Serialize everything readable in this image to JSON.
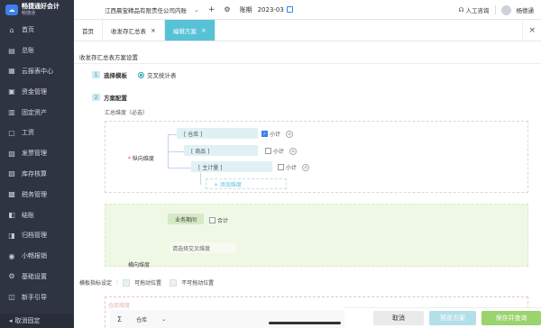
{
  "brand": {
    "name": "畅捷通好会计",
    "sub": "畅捷通"
  },
  "sidebar": {
    "items": [
      {
        "label": "首页",
        "icon": "home-icon",
        "glyph": "⌂"
      },
      {
        "label": "总账",
        "icon": "ledger-icon",
        "glyph": "▤"
      },
      {
        "label": "云报表中心",
        "icon": "report-icon",
        "glyph": "▦"
      },
      {
        "label": "资金管理",
        "icon": "fund-icon",
        "glyph": "▣"
      },
      {
        "label": "固定资产",
        "icon": "asset-icon",
        "glyph": "▥"
      },
      {
        "label": "工资",
        "icon": "salary-icon",
        "glyph": "▢"
      },
      {
        "label": "发票管理",
        "icon": "invoice-icon",
        "glyph": "▧"
      },
      {
        "label": "库存核算",
        "icon": "inventory-icon",
        "glyph": "▨"
      },
      {
        "label": "税务管理",
        "icon": "tax-icon",
        "glyph": "▩"
      },
      {
        "label": "结账",
        "icon": "close-period-icon",
        "glyph": "◧"
      },
      {
        "label": "归档管理",
        "icon": "archive-icon",
        "glyph": "◨"
      },
      {
        "label": "小畅报销",
        "icon": "reimburse-icon",
        "glyph": "◉"
      },
      {
        "label": "基础设置",
        "icon": "settings-icon",
        "glyph": "⚙"
      },
      {
        "label": "新手引导",
        "icon": "guide-icon",
        "glyph": "◫"
      },
      {
        "label": "畅会计",
        "icon": "app-icon",
        "glyph": "◪"
      }
    ],
    "footer": "取消固定"
  },
  "topbar": {
    "company": "江西晨宝精品有限责任公司内账",
    "period_label": "账期",
    "period_value": "2023-03",
    "service": "人工咨询",
    "user": "杨德通"
  },
  "tabs": [
    {
      "label": "首页",
      "active": false,
      "closable": false
    },
    {
      "label": "收发存汇总表",
      "active": false,
      "closable": true
    },
    {
      "label": "编辑方案",
      "active": true,
      "closable": true
    }
  ],
  "main": {
    "title": "收发存汇总表方案设置",
    "step1": {
      "num": "1",
      "label": "选择模板",
      "option": "交叉统计表"
    },
    "step2": {
      "num": "2",
      "label": "方案配置"
    },
    "summary_dim_label": "汇总维度（必选）",
    "vertical_dim_label": "纵向维度",
    "dims": [
      {
        "label": "[ 仓库 ]",
        "subtotal_label": "小计",
        "checked": true
      },
      {
        "label": "[ 商品 ]",
        "subtotal_label": "小计",
        "checked": false
      },
      {
        "label": "[ 主计量 ]",
        "subtotal_label": "小计",
        "checked": false
      }
    ],
    "add_dim": "+ 添加维度",
    "business_period": "业务期间",
    "total_label": "合计",
    "cross_select": "请选择交叉维度",
    "horizontal_dim_label": "横向维度",
    "legend": {
      "title": "横板指标设定",
      "movable": "可拖动位置",
      "fixed": "不可拖动位置"
    },
    "table": {
      "header_label": "仓库维度",
      "sigma": "Σ",
      "col1": "仓库"
    }
  },
  "footer": {
    "cancel": "取消",
    "preview": "预览方案",
    "save": "保存并查询"
  }
}
